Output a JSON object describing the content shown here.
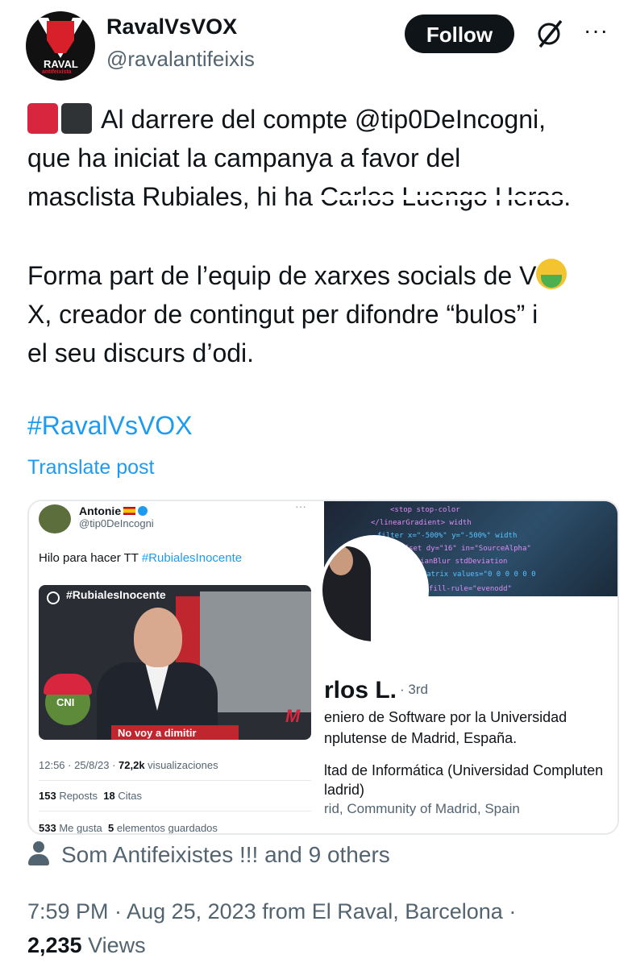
{
  "author": {
    "name": "RavalVsVOX",
    "handle": "@ravalantifeixis",
    "avatar_text": "RAVAL",
    "avatar_subtext": "antifeixista"
  },
  "header": {
    "follow_label": "Follow",
    "grok_icon": "grok-slash-icon",
    "more_label": "···"
  },
  "post": {
    "line1_prefix": "Al darrere del compte @tip0DeIncogni,",
    "line2": "que ha iniciat la campanya a favor del",
    "line3_prefix": "masclista Rubiales, hi ha ",
    "line3_strike": "Carlos Luengo Heras.",
    "line4": "Forma part de l’equip de xarxes socials de V",
    "line5": "X, creador de contingut per difondre “bulos” i",
    "line6": "el seu discurs d’odi.",
    "hashtag": "#RavalVsVOX",
    "translate": "Translate post",
    "flag_colors": [
      "#d7263d",
      "#2f3336"
    ]
  },
  "embedded_tweet": {
    "name": "Antonie",
    "handle": "@tip0DeIncogni",
    "dots": "···",
    "text_prefix": "Hilo para hacer TT ",
    "text_tag": "#RubialesInocente",
    "video_tag": "#RubialesInocente",
    "video_caption": "No voy a dimitir",
    "pepe_cap": "CNI",
    "media_logo": "M",
    "meta_time": "12:56 · 25/8/23 · ",
    "meta_views": "72,2k",
    "meta_views_label": " visualizaciones",
    "reposts": "153",
    "reposts_label": " Reposts",
    "quotes": "18",
    "quotes_label": " Citas",
    "likes": "533",
    "likes_label": " Me gusta",
    "saves": "5",
    "saves_label": " elementos guardados"
  },
  "profile_card": {
    "name": "rlos L.",
    "degree": "· 3rd",
    "line1": "eniero de Software por la Universidad",
    "line2": "nplutense de Madrid, España.",
    "line3": "ltad de Informática (Universidad Compluten",
    "line4": "ladrid)",
    "location": "rid, Community of Madrid, Spain"
  },
  "footer": {
    "liked_by": "Som Antifeixistes !!! and 9 others",
    "timestamp": "7:59 PM · Aug 25, 2023 from El Raval, Barcelona ·",
    "views_count": "2,235",
    "views_label": "Views"
  }
}
